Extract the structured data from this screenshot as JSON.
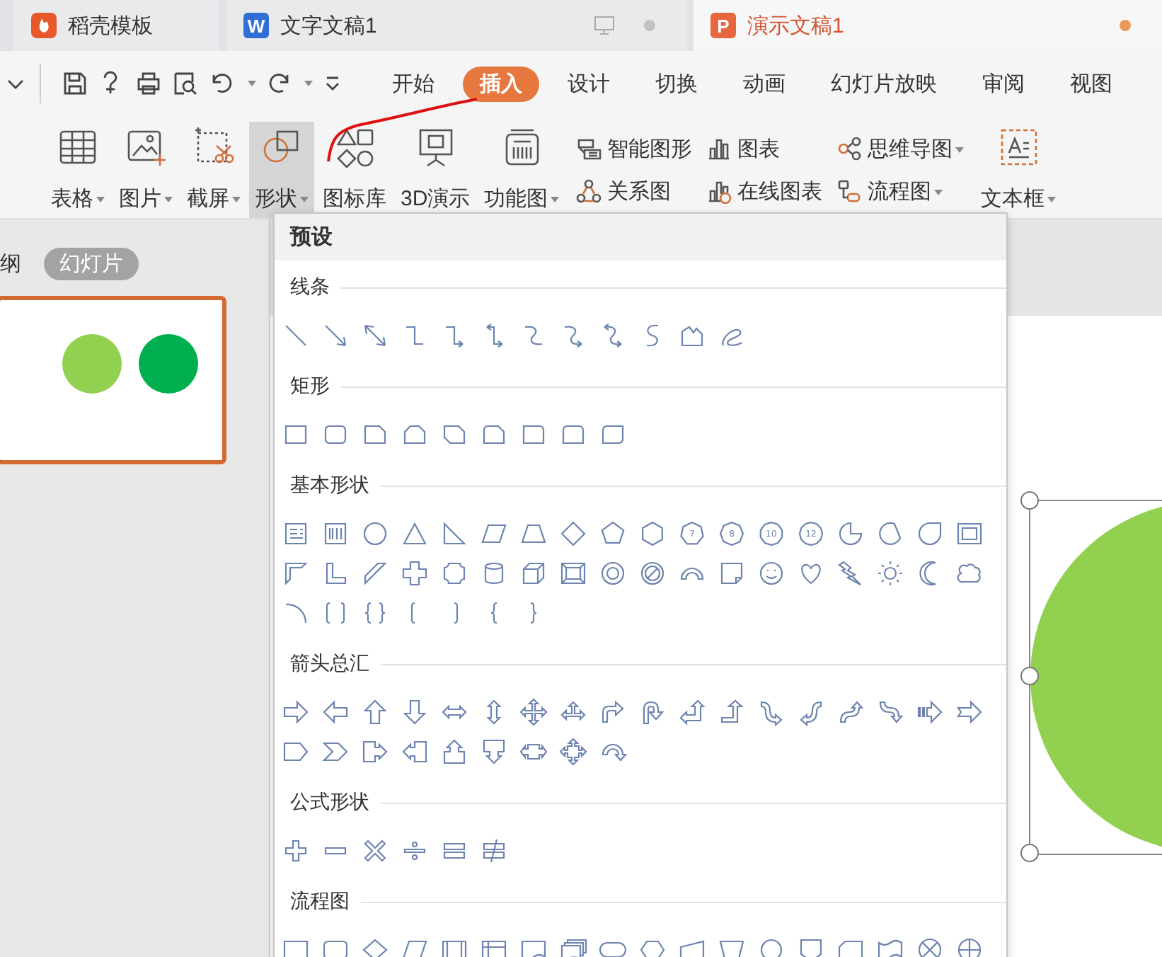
{
  "tabs": [
    {
      "label": "稻壳模板",
      "selected": false
    },
    {
      "label": "文字文稿1",
      "icon_text": "W",
      "selected": false
    },
    {
      "label": "演示文稿1",
      "icon_text": "P",
      "selected": true
    }
  ],
  "menu": [
    {
      "label": "开始",
      "selected": false
    },
    {
      "label": "插入",
      "selected": true
    },
    {
      "label": "设计",
      "selected": false
    },
    {
      "label": "切换",
      "selected": false
    },
    {
      "label": "动画",
      "selected": false
    },
    {
      "label": "幻灯片放映",
      "selected": false
    },
    {
      "label": "审阅",
      "selected": false
    },
    {
      "label": "视图",
      "selected": false
    }
  ],
  "ribbon": {
    "large": [
      {
        "label": "表格",
        "dropdown": true,
        "pressed": false
      },
      {
        "label": "图片",
        "dropdown": true,
        "pressed": false
      },
      {
        "label": "截屏",
        "dropdown": true,
        "pressed": false
      },
      {
        "label": "形状",
        "dropdown": true,
        "pressed": true
      },
      {
        "label": "图标库",
        "dropdown": false,
        "pressed": false
      },
      {
        "label": "3D演示",
        "dropdown": false,
        "pressed": false
      },
      {
        "label": "功能图",
        "dropdown": true,
        "pressed": false
      }
    ],
    "small": [
      {
        "label": "智能图形",
        "dropdown": false
      },
      {
        "label": "关系图",
        "dropdown": false
      },
      {
        "label": "图表",
        "dropdown": false
      },
      {
        "label": "在线图表",
        "dropdown": false
      },
      {
        "label": "思维导图",
        "dropdown": true
      },
      {
        "label": "流程图",
        "dropdown": true
      }
    ],
    "text_box": {
      "label": "文本框",
      "dropdown": true
    }
  },
  "left_panel": {
    "outline_tab": "纲",
    "slides_tab": "幻灯片"
  },
  "shapes_menu": {
    "header": "预设",
    "sections": [
      {
        "title": "线条",
        "kind": "lines"
      },
      {
        "title": "矩形",
        "kind": "rectangles"
      },
      {
        "title": "基本形状",
        "kind": "basic",
        "polygon_labels": [
          "7",
          "8",
          "10",
          "12"
        ]
      },
      {
        "title": "箭头总汇",
        "kind": "arrows"
      },
      {
        "title": "公式形状",
        "kind": "equation"
      },
      {
        "title": "流程图",
        "kind": "flowchart"
      }
    ]
  }
}
